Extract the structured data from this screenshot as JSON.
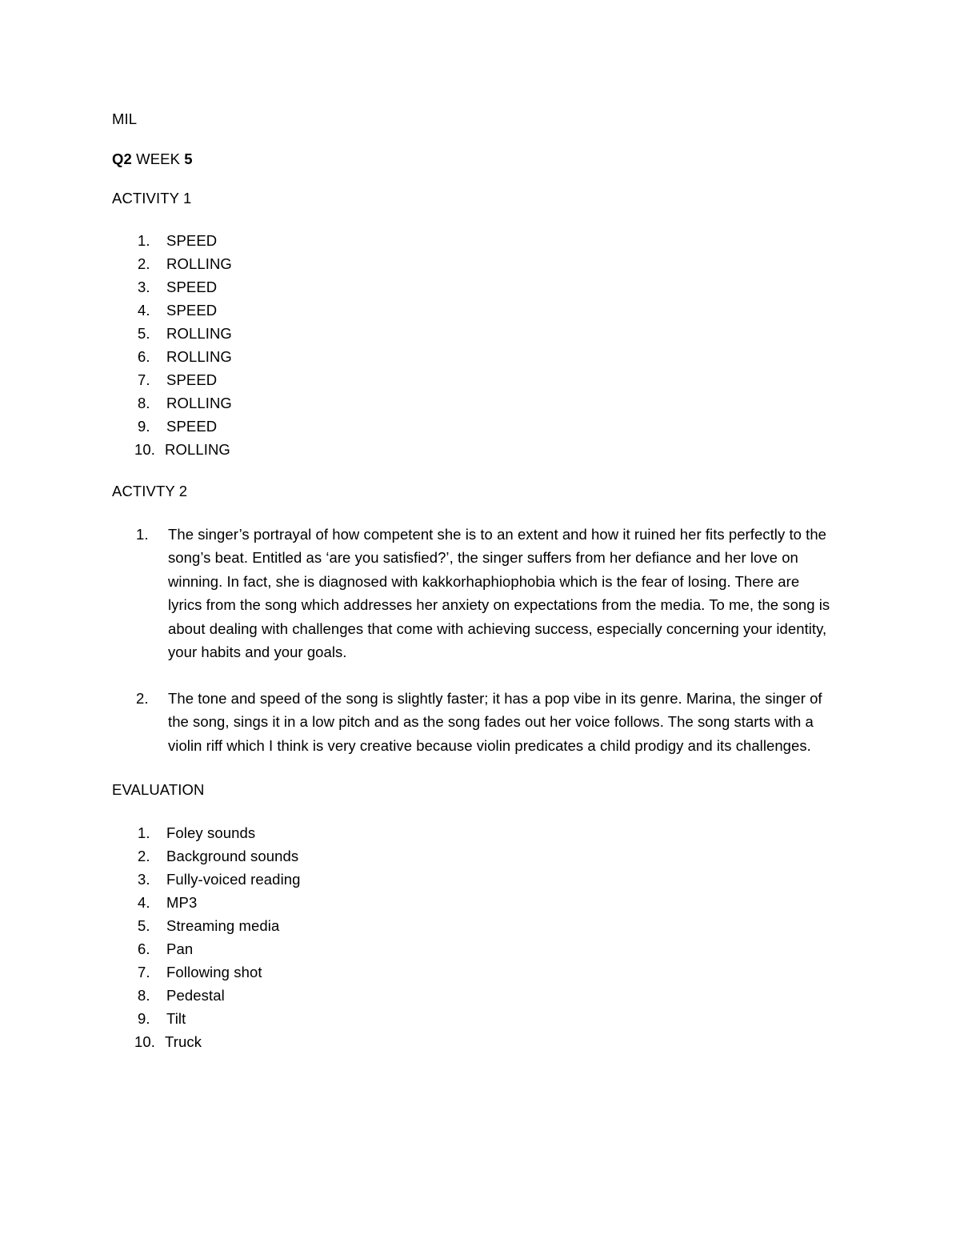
{
  "document": {
    "subject": "MIL",
    "week_prefix": "Q2",
    "week_middle": " WEEK ",
    "week_number": "5",
    "activity1_heading": "ACTIVITY 1",
    "activity2_heading": "ACTIVTY 2",
    "evaluation_heading": "EVALUATION"
  },
  "activity1": {
    "items": [
      {
        "num": "1.",
        "text": "SPEED"
      },
      {
        "num": "2.",
        "text": "ROLLING"
      },
      {
        "num": "3.",
        "text": "SPEED"
      },
      {
        "num": "4.",
        "text": "SPEED"
      },
      {
        "num": "5.",
        "text": "ROLLING"
      },
      {
        "num": "6.",
        "text": "ROLLING"
      },
      {
        "num": "7.",
        "text": "SPEED"
      },
      {
        "num": "8.",
        "text": "ROLLING"
      },
      {
        "num": "9.",
        "text": "SPEED"
      },
      {
        "num": "10.",
        "text": "ROLLING"
      }
    ]
  },
  "activity2": {
    "items": [
      {
        "num": "1.",
        "text": "The singer’s portrayal of how competent she is to an extent and how it ruined her fits perfectly to the song’s beat. Entitled as ‘are you satisfied?’, the singer suffers from her defiance and her love on winning. In fact, she is diagnosed with kakkorhaphiophobia which is the fear of losing. There are lyrics from the song which addresses her anxiety on expectations from the media. To me, the song is about dealing with challenges that come with achieving success, especially concerning your identity, your habits and your goals."
      },
      {
        "num": "2.",
        "text": "The tone and speed of the song is slightly faster; it has a pop vibe in its genre.  Marina, the singer of the song, sings it in a low pitch and as the song fades out her voice follows. The song starts with a violin riff which I think is very creative because violin predicates a child prodigy and its challenges."
      }
    ]
  },
  "evaluation": {
    "items": [
      {
        "num": "1.",
        "text": "Foley sounds"
      },
      {
        "num": "2.",
        "text": "Background sounds"
      },
      {
        "num": "3.",
        "text": "Fully-voiced reading"
      },
      {
        "num": "4.",
        "text": "MP3"
      },
      {
        "num": "5.",
        "text": "Streaming media"
      },
      {
        "num": "6.",
        "text": "Pan"
      },
      {
        "num": "7.",
        "text": "Following shot"
      },
      {
        "num": "8.",
        "text": "Pedestal"
      },
      {
        "num": "9.",
        "text": "Tilt"
      },
      {
        "num": "10.",
        "text": "Truck"
      }
    ]
  }
}
